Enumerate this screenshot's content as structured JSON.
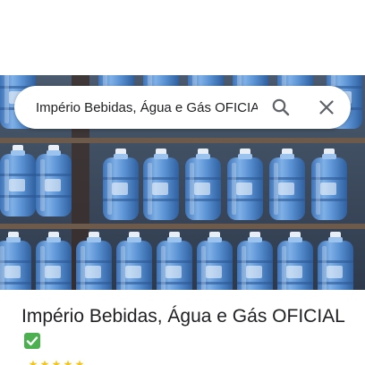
{
  "place": {
    "title": "Império Bebidas, Água e Gás OFICIAL",
    "verified_icon": "check-box-emoji",
    "rating_icons": [
      "star-icon",
      "star-icon",
      "star-icon",
      "star-icon",
      "star-icon"
    ]
  },
  "search": {
    "query": "Império Bebidas, Água e Gás OFICIAL",
    "search_icon": "search-icon",
    "close_icon": "close-icon"
  },
  "hero": {
    "image_subject": "water-jugs-photo"
  },
  "colors": {
    "verified_green": "#4caf50",
    "star": "#f5c518",
    "text": "#202124",
    "icon": "#5f6368"
  }
}
